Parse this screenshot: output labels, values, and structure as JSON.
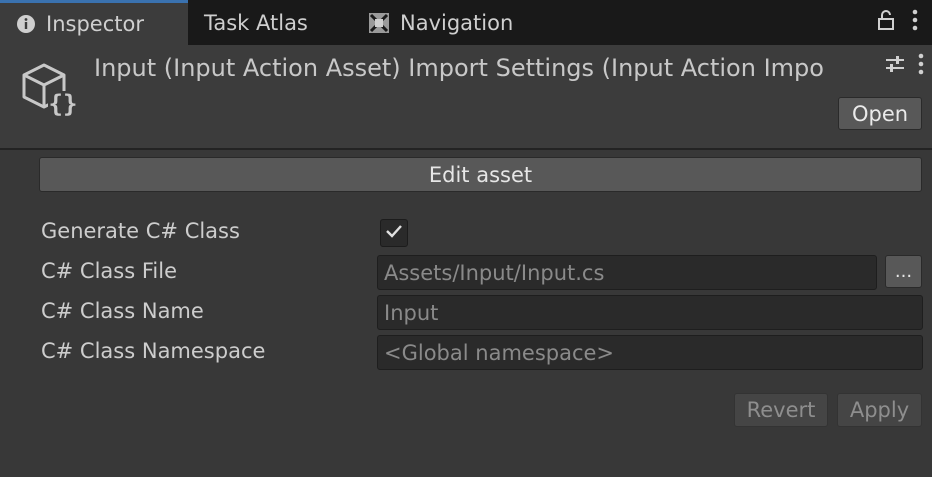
{
  "tabs": [
    {
      "label": "Inspector",
      "icon": "info-icon",
      "active": true
    },
    {
      "label": "Task Atlas",
      "icon": "",
      "active": false
    },
    {
      "label": "Navigation",
      "icon": "navigation-icon",
      "active": false
    }
  ],
  "tabbar_actions": {
    "lock_icon": "lock-icon",
    "menu_icon": "kebab-menu-icon"
  },
  "header": {
    "title": "Input (Input Action Asset) Import Settings (Input Action Impo",
    "asset_icon": "input-action-asset-icon",
    "settings_icon": "presets-icon",
    "menu_icon": "kebab-menu-icon",
    "open_label": "Open"
  },
  "body": {
    "edit_asset_label": "Edit asset",
    "rows": [
      {
        "label": "Generate C# Class",
        "type": "checkbox",
        "checked": true
      },
      {
        "label": "C# Class File",
        "value": "Assets/Input/Input.cs",
        "browse_label": "..."
      },
      {
        "label": "C# Class Name",
        "placeholder": "Input"
      },
      {
        "label": "C# Class Namespace",
        "placeholder": "<Global namespace>"
      }
    ]
  },
  "footer": {
    "revert_label": "Revert",
    "apply_label": "Apply"
  },
  "colors": {
    "background": "#383838",
    "tabbar": "#191919",
    "accent": "#3a72b0",
    "button": "#585858",
    "field": "#2a2a2a"
  }
}
